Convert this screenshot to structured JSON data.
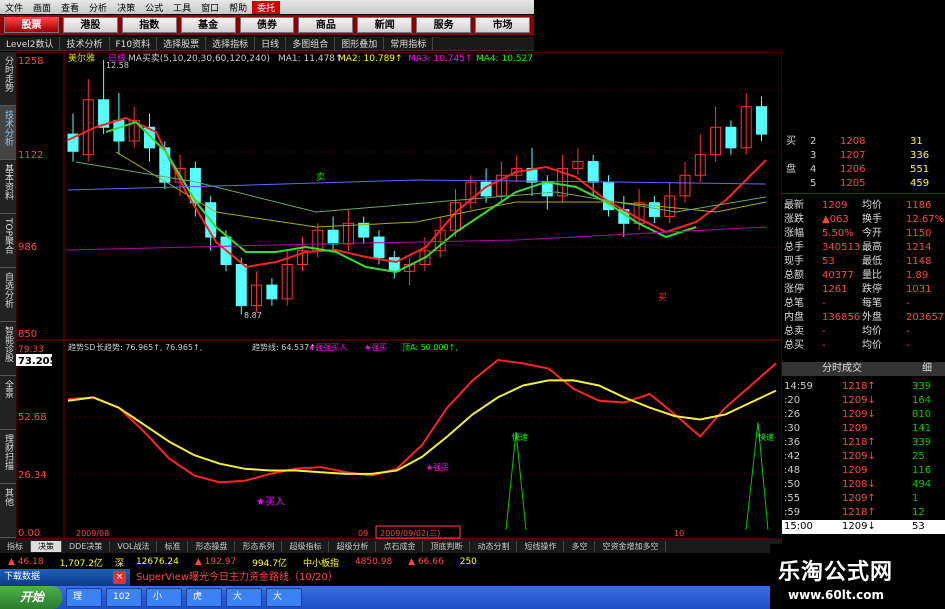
{
  "menu": [
    "文件",
    "画面",
    "查看",
    "分析",
    "决策",
    "公式",
    "工具",
    "窗口",
    "帮助",
    "委托"
  ],
  "nav": [
    "股票",
    "港股",
    "指数",
    "基金",
    "债券",
    "商品",
    "新闻",
    "服务",
    "市场"
  ],
  "toolbar": [
    "Level2数认",
    "技术分析",
    "F10资料",
    "选择股票",
    "选择指标",
    "日线",
    "多图组合",
    "图形叠加",
    "常用指标"
  ],
  "side_tabs": [
    "分时走势",
    "技术分析",
    "基本资料",
    "TOP聚合",
    "自选分析",
    "智能诊股",
    "全景",
    "理财扫描",
    "其他"
  ],
  "chart": {
    "stock_name": "美尔雅",
    "period": "日线",
    "ma_label": "MA买卖(5,10,20,30,60,120,240)",
    "ma1": "MA1: 11.478↑",
    "ma2": "MA2: 10.789↑",
    "ma3": "MA3: 10.745↑",
    "ma4": "MA4: 10.527",
    "y_top": "1258",
    "y_1122": "1122",
    "y_986": "986",
    "y_850": "850",
    "high_mark": "12.58",
    "low_mark": "8.87",
    "buy_mark": "卖",
    "sell_mark": "买",
    "ind_title": "趋势SD",
    "ind_vals": "长趋势: 76.965↑, 76.965↑,",
    "ind_trend": "趋势线: 64.537↑,",
    "ind_strong": "★强强买入",
    "ind_drop": "★强买",
    "ind_50": "顶A: 50.000↑,",
    "ind_y1": "73.205",
    "ind_y2": "52.68",
    "ind_y3": "26.34",
    "ind_y4": "0.00",
    "ind_y0": "79.33",
    "buy_label": "★买入",
    "strong_label": "★强买",
    "fast1": "快速",
    "fast2": "快速",
    "date1": "2009/08",
    "date2": "2009/09/02(三)",
    "date_10": "10",
    "date_09": "09"
  },
  "chart_data": {
    "type": "line",
    "title": "趋势SD",
    "series": [
      {
        "name": "长趋势",
        "values": [
          77,
          78,
          72,
          58,
          42,
          32,
          28,
          29,
          33,
          36,
          37,
          34,
          32,
          36,
          50,
          72,
          88,
          100,
          98,
          95,
          83,
          76,
          75,
          80,
          68,
          55,
          72,
          85,
          98
        ]
      },
      {
        "name": "趋势线",
        "values": [
          76,
          78,
          72,
          62,
          52,
          44,
          39,
          36,
          35,
          35,
          34,
          33,
          33,
          35,
          43,
          55,
          68,
          78,
          85,
          88,
          88,
          85,
          78,
          72,
          67,
          65,
          68,
          75,
          82
        ]
      }
    ]
  },
  "quote": {
    "ob": [
      [
        "买",
        "2",
        "1208",
        "31"
      ],
      [
        "",
        "3",
        "1207",
        "336"
      ],
      [
        "盘",
        "4",
        "1206",
        "551"
      ],
      [
        "",
        "5",
        "1205",
        "459"
      ]
    ],
    "rows": [
      [
        "最新",
        "1209",
        "均价",
        "1186"
      ],
      [
        "涨跌",
        "▲063",
        "换手",
        "12.67%"
      ],
      [
        "涨幅",
        "5.50%",
        "今开",
        "1150"
      ],
      [
        "总手",
        "340513",
        "最高",
        "1214"
      ],
      [
        "现手",
        "53",
        "最低",
        "1148"
      ],
      [
        "总额",
        "40377",
        "量比",
        "1.89"
      ],
      [
        "涨停",
        "1261",
        "跌停",
        "1031"
      ],
      [
        "总笔",
        "-",
        "每笔",
        "-"
      ],
      [
        "内盘",
        "136856",
        "外盘",
        "203657"
      ],
      [
        "总卖",
        "-",
        "均价",
        "-"
      ],
      [
        "总买",
        "-",
        "均价",
        "-"
      ]
    ],
    "tick_tabs": [
      "分时成交",
      "细"
    ],
    "ticks": [
      [
        "14:59",
        "1218↑",
        "339"
      ],
      [
        ":20",
        "1209↓",
        "164"
      ],
      [
        ":26",
        "1209↓",
        "810"
      ],
      [
        ":30",
        "1209",
        "141"
      ],
      [
        ":36",
        "1218↑",
        "339"
      ],
      [
        ":42",
        "1209↓",
        "25"
      ],
      [
        ":48",
        "1209",
        "116"
      ],
      [
        ":50",
        "1208↓",
        "494"
      ],
      [
        ":55",
        "1209↑",
        "1"
      ],
      [
        ":59",
        "1218↑",
        "12"
      ],
      [
        "15:00",
        "1209↓",
        "53"
      ]
    ]
  },
  "bottom_tabs": [
    "指标",
    "决策",
    "DDE决策",
    "VOL战法",
    "标准",
    "形态操盘",
    "形态系列",
    "超级指标",
    "超级分析",
    "点石成金",
    "顶底判断",
    "动态分割",
    "短线操作",
    "多空",
    "空资金增加多空"
  ],
  "status": {
    "a": "▲ 46.18",
    "b": "1,707.2亿",
    "c": "深",
    "d": "12676.24",
    "e": "▲ 192.97",
    "f": "994.7亿",
    "g": "中小板指",
    "h": "4850.98",
    "i": "▲ 66.66",
    "j": "250"
  },
  "popup": {
    "title": "下载数据",
    "close": "×"
  },
  "ticker": "SuperView曝光今日主力资金路线（10/20）",
  "taskbar": [
    "开始",
    "理",
    "102",
    "小",
    "虎",
    "大",
    "大"
  ],
  "brand": {
    "title": "乐淘公式网",
    "url": "www.60lt.com"
  }
}
